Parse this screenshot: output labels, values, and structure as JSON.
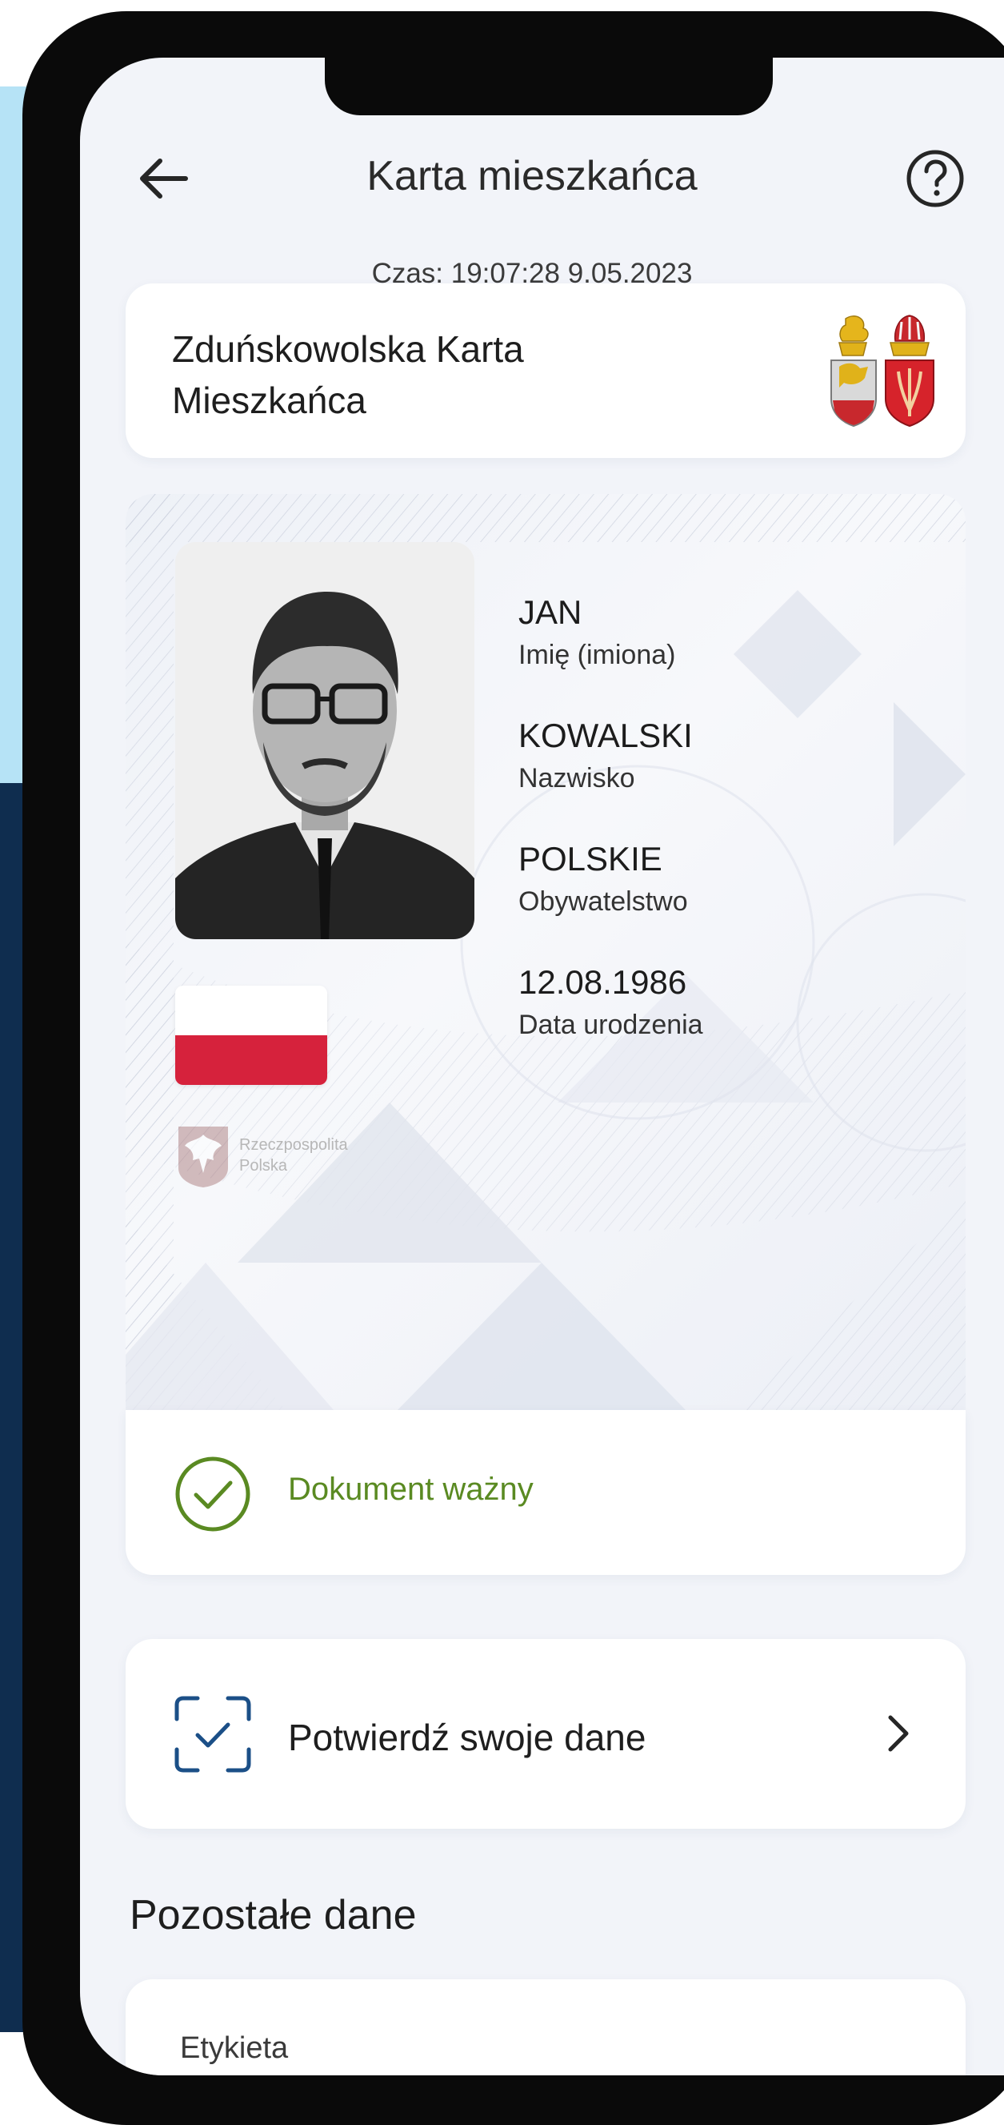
{
  "header": {
    "title": "Karta mieszkańca",
    "back_icon": "arrow-left-icon",
    "help_icon": "question-circle-icon"
  },
  "time": "Czas: 19:07:28 9.05.2023",
  "card_title": "Zduńskowolska Karta Mieszkańca",
  "coat_of_arms_icon": "city-coat-of-arms-icon",
  "person": {
    "first_name": "JAN",
    "first_name_label": "Imię (imiona)",
    "last_name": "KOWALSKI",
    "last_name_label": "Nazwisko",
    "citizenship": "POLSKIE",
    "citizenship_label": "Obywatelstwo",
    "birth_date": "12.08.1986",
    "birth_date_label": "Data urodzenia"
  },
  "emblem": {
    "line1": "Rzeczpospolita",
    "line2": "Polska"
  },
  "status": {
    "text": "Dokument ważny",
    "icon": "check-circle-icon",
    "color": "#5a8a22"
  },
  "confirm": {
    "label": "Potwierdź swoje dane",
    "icon": "scan-check-icon",
    "chevron_icon": "chevron-right-icon"
  },
  "other_data": {
    "section_title": "Pozostałe dane",
    "first_label": "Etykieta"
  },
  "colors": {
    "accent_blue": "#1b4f87",
    "flag_red": "#d6223c",
    "status_green": "#5a8a22"
  }
}
